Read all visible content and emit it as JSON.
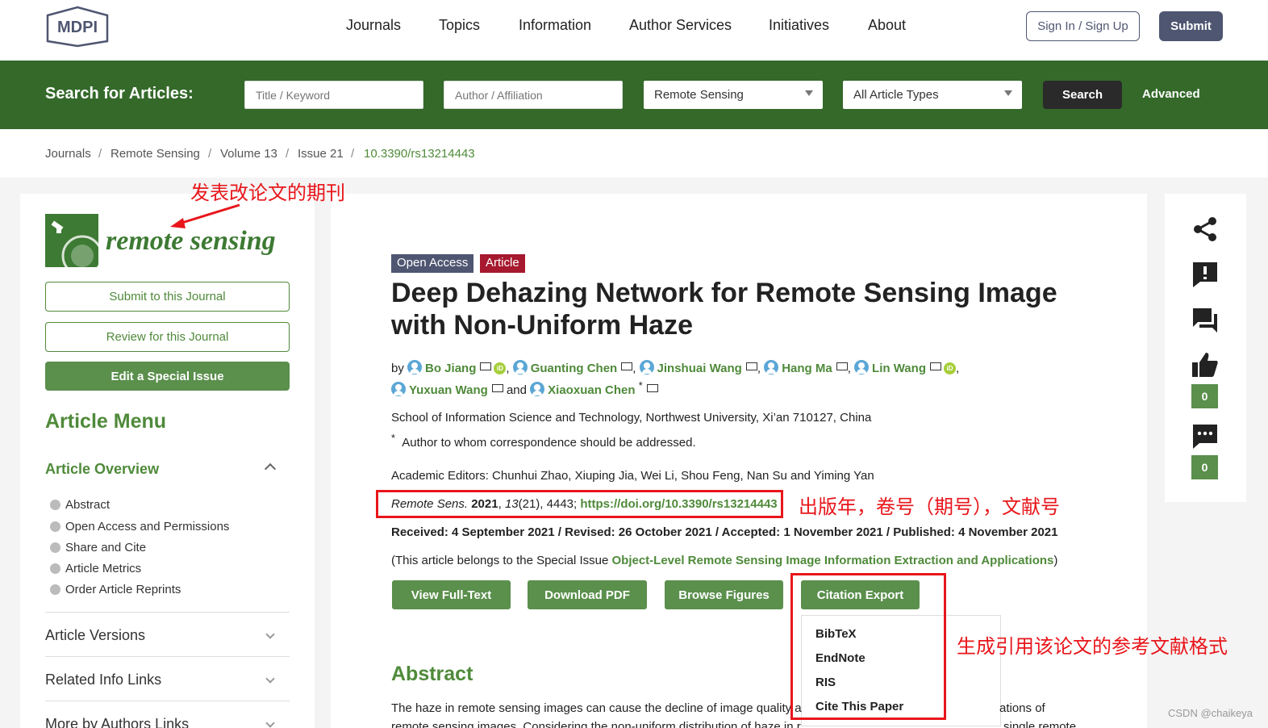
{
  "header": {
    "logo": "MDPI",
    "nav": [
      "Journals",
      "Topics",
      "Information",
      "Author Services",
      "Initiatives",
      "About"
    ],
    "signin_label": "Sign In / Sign Up",
    "submit_label": "Submit"
  },
  "search": {
    "label": "Search for Articles:",
    "title_placeholder": "Title / Keyword",
    "author_placeholder": "Author / Affiliation",
    "journal_value": "Remote Sensing",
    "type_value": "All Article Types",
    "search_label": "Search",
    "advanced_label": "Advanced"
  },
  "breadcrumb": {
    "items": [
      "Journals",
      "Remote Sensing",
      "Volume 13",
      "Issue 21",
      "10.3390/rs13214443"
    ],
    "separator": "/"
  },
  "sidebar": {
    "journal_name": "remote sensing",
    "submit_label": "Submit to this Journal",
    "review_label": "Review for this Journal",
    "edit_special_label": "Edit a Special Issue",
    "menu_title": "Article Menu",
    "overview_title": "Article Overview",
    "overview_items": [
      "Abstract",
      "Open Access and Permissions",
      "Share and Cite",
      "Article Metrics",
      "Order Article Reprints"
    ],
    "sections": [
      "Article Versions",
      "Related Info Links",
      "More by Authors Links"
    ]
  },
  "article": {
    "badge_open_access": "Open Access",
    "badge_type": "Article",
    "title": "Deep Dehazing Network for Remote Sensing Image with Non-Uniform Haze",
    "by": "by",
    "authors": [
      "Bo Jiang",
      "Guanting Chen",
      "Jinshuai Wang",
      "Hang Ma",
      "Lin Wang",
      "Yuxuan Wang",
      "Xiaoxuan Chen"
    ],
    "comma": ",",
    "and": "and",
    "asterisk": "*",
    "orcid": "iD",
    "affiliation": "School of Information Science and Technology, Northwest University, Xi’an 710127, China",
    "correspondence_mark": "*",
    "correspondence": "Author to whom correspondence should be addressed.",
    "editors": "Academic Editors: Chunhui Zhao, Xiuping Jia, Wei Li, Shou Feng, Nan Su and Yiming Yan",
    "citation_journal": "Remote Sens.",
    "citation_year": "2021",
    "citation_volume": "13",
    "citation_rest": "(21), 4443;",
    "citation_doi": "https://doi.org/10.3390/rs13214443",
    "dates": "Received: 4 September 2021 / Revised: 26 October 2021 / Accepted: 1 November 2021 / Published: 4 November 2021",
    "special_prefix": "(This article belongs to the Special Issue",
    "special_link": "Object-Level Remote Sensing Image Information Extraction and Applications",
    "special_suffix": ")",
    "buttons": [
      "View Full-Text",
      "Download PDF",
      "Browse Figures",
      "Citation Export"
    ],
    "export_options": [
      "BibTeX",
      "EndNote",
      "RIS",
      "Cite This Paper"
    ],
    "abstract_title": "Abstract",
    "abstract_line1": "The haze in remote sensing images can cause the decline of image quality a",
    "abstract_line1_end": "ations of",
    "abstract_line2": "remote sensing images. Considering the non-uniform distribution of haze in r",
    "abstract_line2_end": "single remote"
  },
  "right_sidebar": {
    "icons": [
      "share-icon",
      "report-icon",
      "comment-icon",
      "like-icon",
      "chat-icon"
    ],
    "like_count": "0",
    "comment_count": "0"
  },
  "annotations": {
    "journal_note": "发表改论文的期刊",
    "citation_note": "出版年，卷号（期号），文献号",
    "export_note": "生成引用该论文的参考文献格式"
  },
  "watermark": "CSDN @chaikeya",
  "colors": {
    "brand_green": "#34692a",
    "link_green": "#4f8a3a",
    "button_green": "#5a8f4c",
    "navy": "#4f5671",
    "article_red": "#a6192e",
    "annotation_red": "#e8161b"
  }
}
